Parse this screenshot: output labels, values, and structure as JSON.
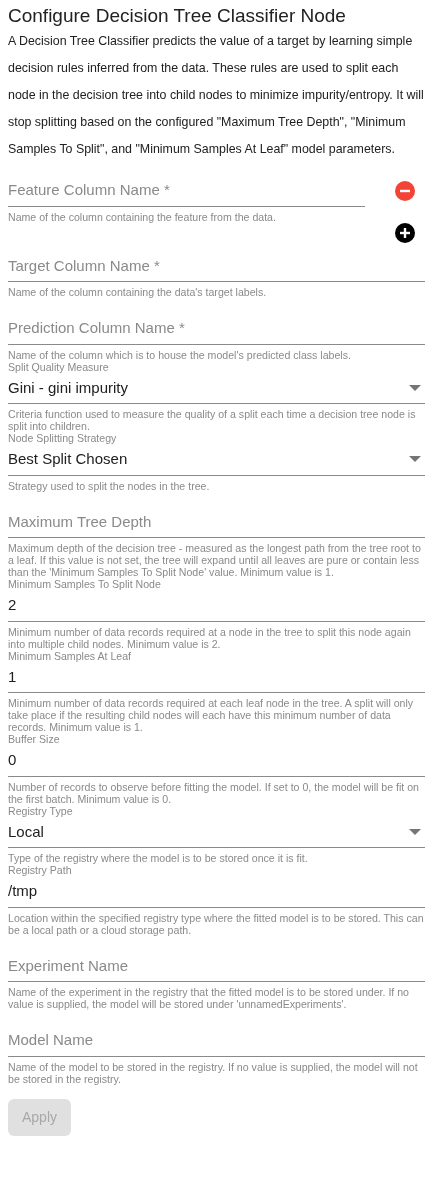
{
  "title": "Configure Decision Tree Classifier Node",
  "description": "A Decision Tree Classifier predicts the value of a target by learning simple decision rules inferred from the data. These rules are used to split each node in the decision tree into child nodes to minimize impurity/entropy. It will stop splitting based on the configured \"Maximum Tree Depth\", \"Minimum Samples To Split\", and \"Minimum Samples At Leaf\" model parameters.",
  "feature_columns": [
    {
      "placeholder": "Feature Column Name *",
      "hint": "Name of the column containing the feature from the data.",
      "removable": true
    }
  ],
  "fields": [
    {
      "kind": "floating",
      "placeholder": "Target Column Name *",
      "hint": "Name of the column containing the data's target labels."
    },
    {
      "kind": "floating",
      "placeholder": "Prediction Column Name *",
      "hint": "Name of the column which is to house the model's predicted class labels."
    },
    {
      "kind": "select",
      "label": "Split Quality Measure",
      "value": "Gini - gini impurity",
      "hint": "Criteria function used to measure the quality of a split each time a decision tree node is split into children."
    },
    {
      "kind": "select",
      "label": "Node Splitting Strategy",
      "value": "Best Split Chosen",
      "hint": "Strategy used to split the nodes in the tree."
    },
    {
      "kind": "floating",
      "placeholder": "Maximum Tree Depth",
      "hint": "Maximum depth of the decision tree - measured as the longest path from the tree root to a leaf. If this value is not set, the tree will expand until all leaves are pure or contain less than the 'Minimum Samples To Split Node' value. Minimum value is 1."
    },
    {
      "kind": "labeled",
      "label": "Minimum Samples To Split Node",
      "value": "2",
      "hint": "Minimum number of data records required at a node in the tree to split this node again into multiple child nodes. Minimum value is 2."
    },
    {
      "kind": "labeled",
      "label": "Minimum Samples At Leaf",
      "value": "1",
      "hint": "Minimum number of data records required at each leaf node in the tree. A split will only take place if the resulting child nodes will each have this minimum number of data records. Minimum value is 1."
    },
    {
      "kind": "labeled",
      "label": "Buffer Size",
      "value": "0",
      "hint": "Number of records to observe before fitting the model. If set to 0, the model will be fit on the first batch. Minimum value is 0."
    },
    {
      "kind": "select",
      "label": "Registry Type",
      "value": "Local",
      "hint": "Type of the registry where the model is to be stored once it is fit."
    },
    {
      "kind": "labeled",
      "label": "Registry Path",
      "value": "/tmp",
      "hint": "Location within the specified registry type where the fitted model is to be stored. This can be a local path or a cloud storage path."
    },
    {
      "kind": "floating",
      "placeholder": "Experiment Name",
      "hint": "Name of the experiment in the registry that the fitted model is to be stored under. If no value is supplied, the model will be stored under 'unnamedExperiments'."
    },
    {
      "kind": "floating",
      "placeholder": "Model Name",
      "hint": "Name of the model to be stored in the registry. If no value is supplied, the model will not be stored in the registry."
    }
  ],
  "apply_button": {
    "label": "Apply",
    "disabled": true
  }
}
